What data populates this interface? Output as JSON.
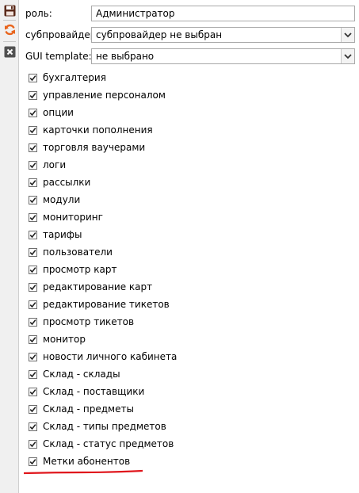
{
  "toolbar": {
    "save_icon": "save-icon",
    "refresh_icon": "refresh-icon",
    "close_icon": "close-icon",
    "colors": {
      "save": "#5a2a1a",
      "refresh": "#e8641c",
      "close": "#505050"
    }
  },
  "form": {
    "role_label": "роль:",
    "role_value": "Администратор",
    "subprovider_label": "субпровайдер:",
    "subprovider_value": "субпровайдер не выбран",
    "template_label": "GUI template:",
    "template_value": "не выбрано"
  },
  "permissions": [
    {
      "label": "бухгалтерия",
      "checked": true
    },
    {
      "label": "управление персоналом",
      "checked": true
    },
    {
      "label": "опции",
      "checked": true
    },
    {
      "label": "карточки пополнения",
      "checked": true
    },
    {
      "label": "торговля ваучерами",
      "checked": true
    },
    {
      "label": "логи",
      "checked": true
    },
    {
      "label": "рассылки",
      "checked": true
    },
    {
      "label": "модули",
      "checked": true
    },
    {
      "label": "мониторинг",
      "checked": true
    },
    {
      "label": "тарифы",
      "checked": true
    },
    {
      "label": "пользователи",
      "checked": true
    },
    {
      "label": "просмотр карт",
      "checked": true
    },
    {
      "label": "редактирование карт",
      "checked": true
    },
    {
      "label": "редактирование тикетов",
      "checked": true
    },
    {
      "label": "просмотр тикетов",
      "checked": true
    },
    {
      "label": "монитор",
      "checked": true
    },
    {
      "label": "новости личного кабинета",
      "checked": true
    },
    {
      "label": "Склад - склады",
      "checked": true
    },
    {
      "label": "Склад - поставщики",
      "checked": true
    },
    {
      "label": "Склад - предметы",
      "checked": true
    },
    {
      "label": "Склад - типы предметов",
      "checked": true
    },
    {
      "label": "Склад - статус предметов",
      "checked": true
    },
    {
      "label": "Метки абонентов",
      "checked": true
    }
  ],
  "annotation_color": "#e0161c"
}
